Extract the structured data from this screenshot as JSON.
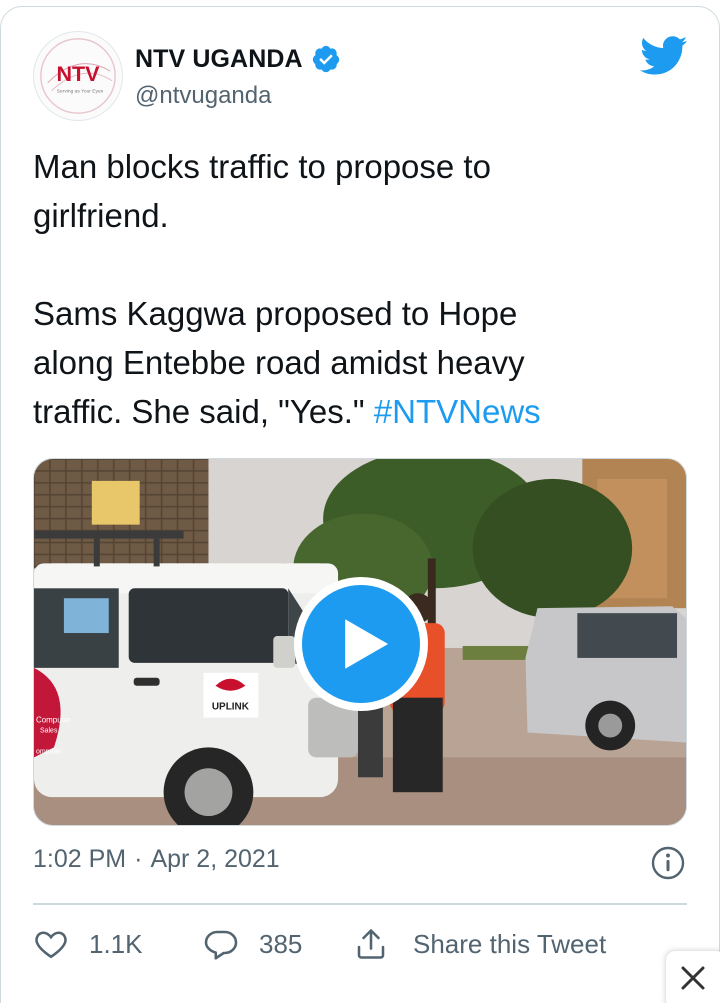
{
  "account": {
    "display_name": "NTV UGANDA",
    "handle": "@ntvuganda",
    "avatar_logo": "NTV",
    "avatar_tagline": "Serving as Your Eyes",
    "verified": true
  },
  "tweet": {
    "text_before_hashtag": "Man blocks traffic to propose to\ngirlfriend.\n\nSams Kaggwa proposed to Hope\nalong Entebbe road amidst heavy\ntraffic. She said, \"Yes.\" ",
    "hashtag": "#NTVNews"
  },
  "media": {
    "type": "video",
    "play_icon": "play-icon",
    "vehicle_text": {
      "brand": "UPLINK",
      "side_line_1": "Computer",
      "side_line_2": "Sales",
      "side_line_3": "omputer"
    }
  },
  "meta": {
    "time": "1:02 PM",
    "separator": "·",
    "date": "Apr 2, 2021"
  },
  "actions": {
    "likes": "1.1K",
    "replies": "385",
    "share_label": "Share this Tweet"
  },
  "colors": {
    "accent": "#1d9bf0",
    "text": "#0f1419",
    "muted": "#536471",
    "border": "#cfd9de"
  },
  "icons": [
    "verified-badge-icon",
    "twitter-bird-icon",
    "play-icon",
    "info-icon",
    "heart-icon",
    "reply-bubble-icon",
    "share-icon",
    "close-icon"
  ]
}
